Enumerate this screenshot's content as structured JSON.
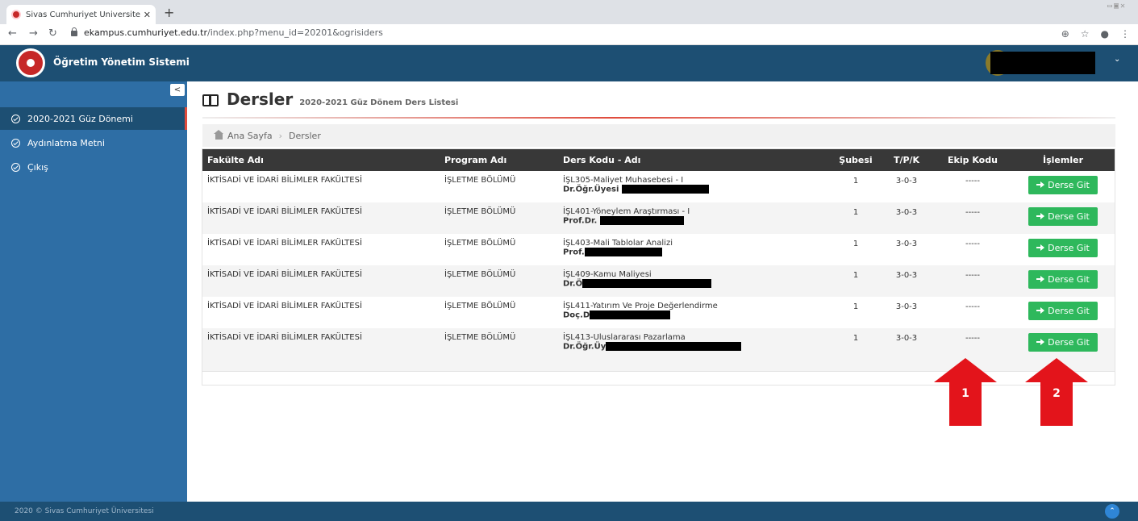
{
  "browser": {
    "tab_title": "Sivas Cumhuriyet Üniversitesi | Onli",
    "url_host": "ekampus.cumhuriyet.edu.tr",
    "url_path": "/index.php?menu_id=20201&ogrisiders"
  },
  "header": {
    "app_title": "Öğretim Yönetim Sistemi"
  },
  "sidebar": {
    "items": [
      {
        "label": "2020-2021 Güz Dönemi",
        "active": true
      },
      {
        "label": "Aydınlatma Metni",
        "active": false
      },
      {
        "label": "Çıkış",
        "active": false
      }
    ]
  },
  "page": {
    "title": "Dersler",
    "subtitle": "2020-2021 Güz Dönem Ders Listesi"
  },
  "breadcrumb": {
    "home": "Ana Sayfa",
    "current": "Dersler"
  },
  "table": {
    "headers": {
      "faculty": "Fakülte Adı",
      "program": "Program Adı",
      "course": "Ders Kodu - Adı",
      "section": "Şubesi",
      "tpk": "T/P/K",
      "team": "Ekip Kodu",
      "actions": "İşlemler"
    },
    "rows": [
      {
        "faculty": "İKTİSADİ VE İDARİ BİLİMLER FAKÜLTESİ",
        "program": "İŞLETME BÖLÜMÜ",
        "course": "İŞL305-Maliyet Muhasebesi - I",
        "teacher": "Dr.Öğr.Üyesi",
        "section": "1",
        "tpk": "3-0-3",
        "team": "-----",
        "action": "Derse Git"
      },
      {
        "faculty": "İKTİSADİ VE İDARİ BİLİMLER FAKÜLTESİ",
        "program": "İŞLETME BÖLÜMÜ",
        "course": "İŞL401-Yöneylem Araştırması - I",
        "teacher": "Prof.Dr.",
        "section": "1",
        "tpk": "3-0-3",
        "team": "-----",
        "action": "Derse Git"
      },
      {
        "faculty": "İKTİSADİ VE İDARİ BİLİMLER FAKÜLTESİ",
        "program": "İŞLETME BÖLÜMÜ",
        "course": "İŞL403-Mali Tablolar Analizi",
        "teacher": "Prof.",
        "section": "1",
        "tpk": "3-0-3",
        "team": "-----",
        "action": "Derse Git"
      },
      {
        "faculty": "İKTİSADİ VE İDARİ BİLİMLER FAKÜLTESİ",
        "program": "İŞLETME BÖLÜMÜ",
        "course": "İŞL409-Kamu Maliyesi",
        "teacher": "Dr.Ö",
        "section": "1",
        "tpk": "3-0-3",
        "team": "-----",
        "action": "Derse Git"
      },
      {
        "faculty": "İKTİSADİ VE İDARİ BİLİMLER FAKÜLTESİ",
        "program": "İŞLETME BÖLÜMÜ",
        "course": "İŞL411-Yatırım Ve Proje Değerlendirme",
        "teacher": "Doç.D",
        "section": "1",
        "tpk": "3-0-3",
        "team": "-----",
        "action": "Derse Git"
      },
      {
        "faculty": "İKTİSADİ VE İDARİ BİLİMLER FAKÜLTESİ",
        "program": "İŞLETME BÖLÜMÜ",
        "course": "İŞL413-Uluslararası Pazarlama",
        "teacher": "Dr.Öğr.Üy",
        "section": "1",
        "tpk": "3-0-3",
        "team": "-----",
        "action": "Derse Git"
      }
    ]
  },
  "callouts": [
    "1",
    "2"
  ],
  "footer": {
    "text": "2020 © Sivas Cumhuriyet Üniversitesi"
  },
  "colors": {
    "header_bg": "#1d4f73",
    "sidebar_bg": "#2e6ea5",
    "button_green": "#2eb85c",
    "callout_red": "#e3141b"
  }
}
